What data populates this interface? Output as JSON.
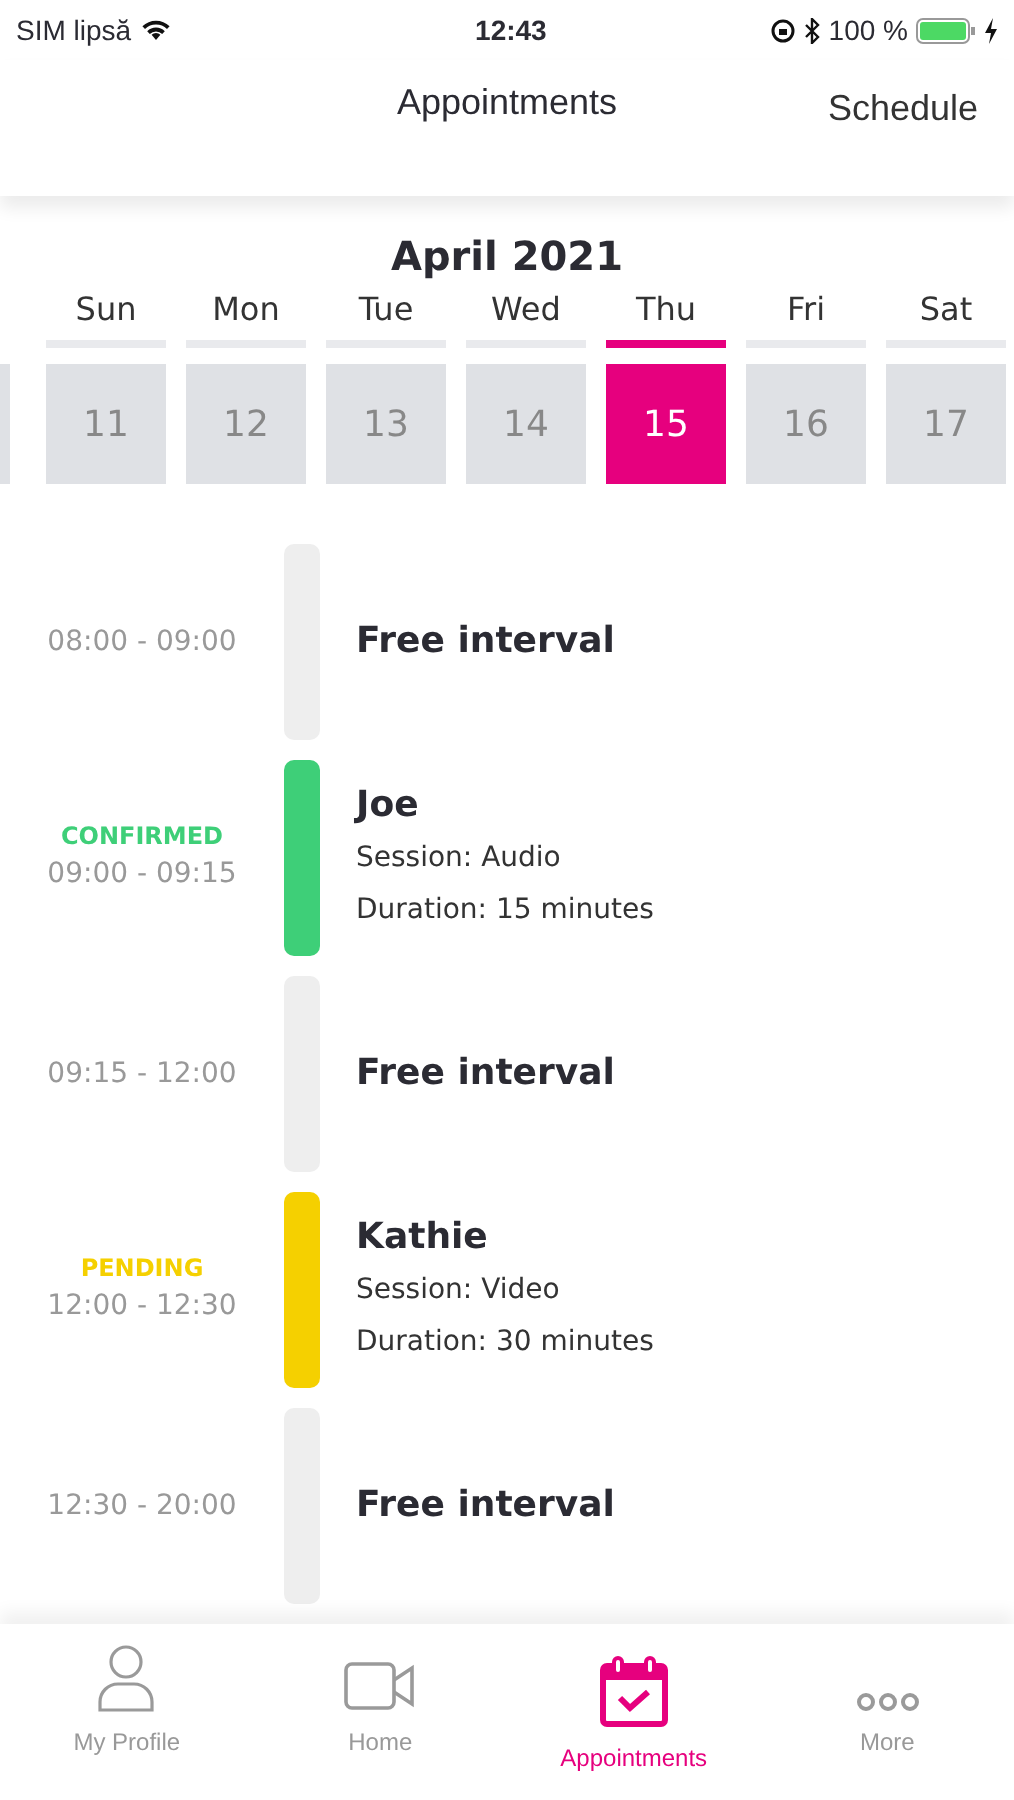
{
  "status_bar": {
    "carrier": "SIM lipsă",
    "time": "12:43",
    "battery": "100 %"
  },
  "header": {
    "title": "Appointments",
    "action": "Schedule"
  },
  "calendar": {
    "month": "April 2021",
    "days": [
      {
        "weekday": "Sun",
        "date": "11",
        "selected": false
      },
      {
        "weekday": "Mon",
        "date": "12",
        "selected": false
      },
      {
        "weekday": "Tue",
        "date": "13",
        "selected": false
      },
      {
        "weekday": "Wed",
        "date": "14",
        "selected": false
      },
      {
        "weekday": "Thu",
        "date": "15",
        "selected": true
      },
      {
        "weekday": "Fri",
        "date": "16",
        "selected": false
      },
      {
        "weekday": "Sat",
        "date": "17",
        "selected": false
      }
    ]
  },
  "slots": [
    {
      "kind": "free",
      "time": "08:00 - 09:00",
      "title": "Free interval"
    },
    {
      "kind": "appointment",
      "status": "CONFIRMED",
      "color": "#3ecf78",
      "time": "09:00 - 09:15",
      "title": "Joe",
      "session": "Session: Audio",
      "duration": "Duration: 15 minutes"
    },
    {
      "kind": "free",
      "time": "09:15 - 12:00",
      "title": "Free interval"
    },
    {
      "kind": "appointment",
      "status": "PENDING",
      "color": "#f5d000",
      "time": "12:00 - 12:30",
      "title": "Kathie",
      "session": "Session: Video",
      "duration": "Duration: 30 minutes"
    },
    {
      "kind": "free",
      "time": "12:30 - 20:00",
      "title": "Free interval"
    }
  ],
  "tab_bar": [
    {
      "kind": "profile",
      "label": "My Profile",
      "selected": false
    },
    {
      "kind": "home",
      "label": "Home",
      "selected": false
    },
    {
      "kind": "appointments",
      "label": "Appointments",
      "selected": true
    },
    {
      "kind": "more",
      "label": "More",
      "selected": false
    }
  ]
}
